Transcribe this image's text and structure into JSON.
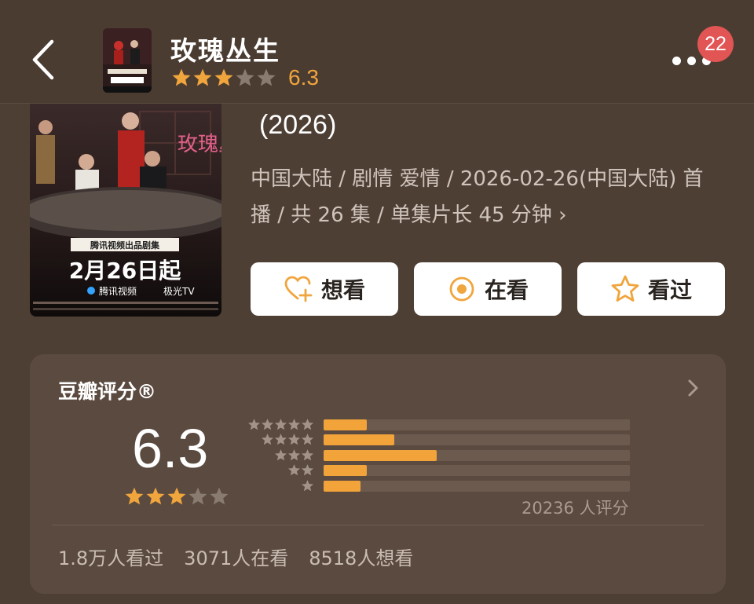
{
  "header": {
    "title": "玫瑰丛生",
    "score": "6.3",
    "star_level": 3,
    "badge_count": "22",
    "back_icon": "chevron-left-icon",
    "more_icon": "more-dots-icon"
  },
  "poster": {
    "title_art": "玫瑰丛生",
    "banner": "腾讯视频出品剧集",
    "date_text": "2月26日起",
    "platform": "腾讯视频",
    "channel": "极光TV"
  },
  "info": {
    "year": "(2026)",
    "meta_line1": "中国大陆 / 剧情 爱情 / 2026-02-26(中国大陆) 首",
    "meta_line2": "播 / 共 26 集 / 单集片长 45 分钟",
    "meta_chevron": "›"
  },
  "actions": [
    {
      "label": "想看",
      "icon": "heart-plus-icon"
    },
    {
      "label": "在看",
      "icon": "target-icon"
    },
    {
      "label": "看过",
      "icon": "star-outline-icon"
    }
  ],
  "rating": {
    "title": "豆瓣评分®",
    "score": "6.3",
    "star_level": 3,
    "rating_count": "20236 人评分",
    "distribution": [
      {
        "stars": 5,
        "fraction": 0.14
      },
      {
        "stars": 4,
        "fraction": 0.23
      },
      {
        "stars": 3,
        "fraction": 0.37
      },
      {
        "stars": 2,
        "fraction": 0.14
      },
      {
        "stars": 1,
        "fraction": 0.12
      }
    ],
    "stats": [
      "1.8万人看过",
      "3071人在看",
      "8518人想看"
    ]
  },
  "colors": {
    "background": "#4e3f35",
    "card": "#5b4a3f",
    "accent": "#f0a53d",
    "badge": "#e25555"
  }
}
